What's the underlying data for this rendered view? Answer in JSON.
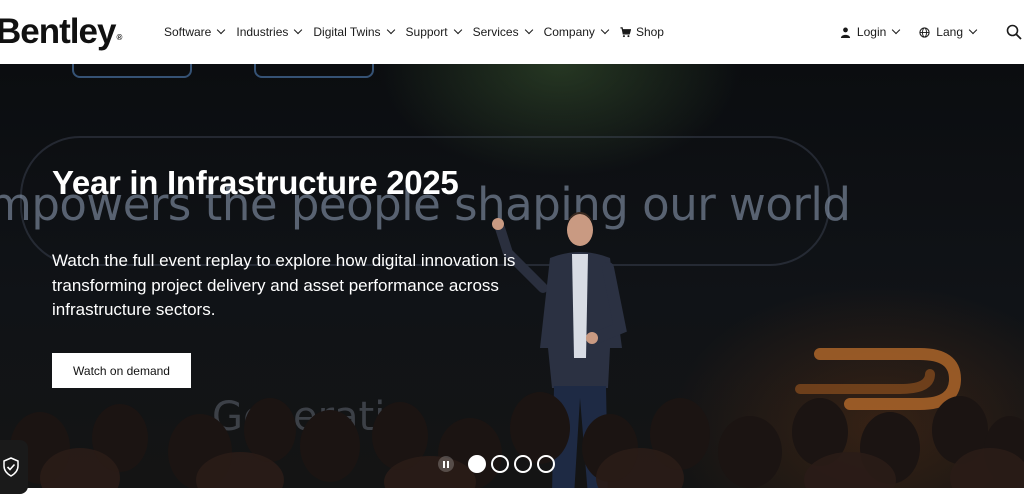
{
  "header": {
    "logo_text": "Bentley",
    "logo_mark": "®",
    "nav": [
      {
        "label": "Software"
      },
      {
        "label": "Industries"
      },
      {
        "label": "Digital Twins"
      },
      {
        "label": "Support"
      },
      {
        "label": "Services"
      },
      {
        "label": "Company"
      }
    ],
    "shop_label": "Shop",
    "login_label": "Login",
    "lang_label": "Lang",
    "icons": {
      "shop": "cart-icon",
      "login": "person-icon",
      "lang": "globe-icon",
      "search": "search-icon"
    }
  },
  "hero": {
    "title": "Year in Infrastructure 2025",
    "backdrop_text": "mpowers the people shaping our world",
    "backdrop_text_2": "Generatio",
    "description": "Watch the full event replay to explore how digital innovation is transforming project delivery and asset performance across infrastructure sectors.",
    "cta_label": "Watch on demand"
  },
  "carousel": {
    "slide_count": 4,
    "active_index": 0,
    "pause_icon": "pause-icon"
  },
  "privacy_badge": {
    "icon": "shield-check-icon"
  },
  "colors": {
    "header_bg": "#ffffff",
    "hero_bg": "#0b0d10",
    "text_light": "#ffffff",
    "text_dark": "#111111"
  }
}
